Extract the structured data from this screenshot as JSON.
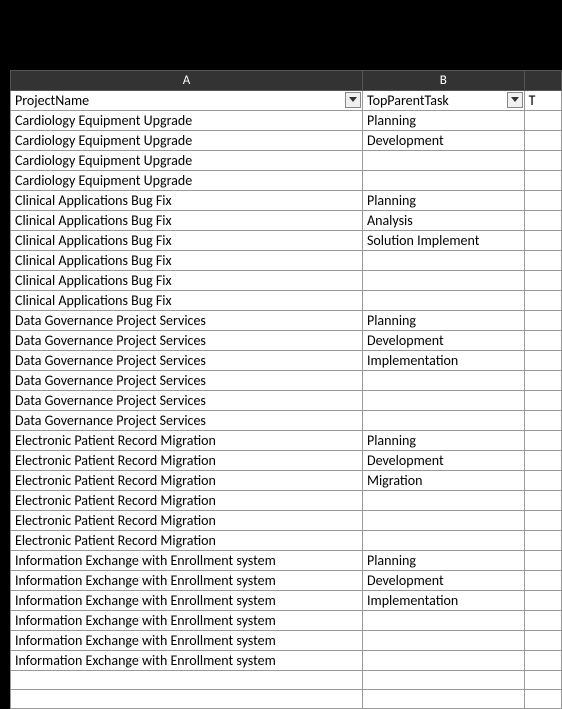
{
  "columns": {
    "A": "A",
    "B": "B",
    "C": ""
  },
  "headers": {
    "project": "ProjectName",
    "topparent": "TopParentTask",
    "partialC": "T"
  },
  "rows": [
    {
      "project": "Cardiology Equipment Upgrade",
      "topparent": "Planning"
    },
    {
      "project": "Cardiology Equipment Upgrade",
      "topparent": "Development"
    },
    {
      "project": "Cardiology Equipment Upgrade",
      "topparent": ""
    },
    {
      "project": "Cardiology Equipment Upgrade",
      "topparent": ""
    },
    {
      "project": "Clinical Applications Bug Fix",
      "topparent": "Planning"
    },
    {
      "project": "Clinical Applications Bug Fix",
      "topparent": "Analysis"
    },
    {
      "project": "Clinical Applications Bug Fix",
      "topparent": "Solution Implement"
    },
    {
      "project": "Clinical Applications Bug Fix",
      "topparent": ""
    },
    {
      "project": "Clinical Applications Bug Fix",
      "topparent": ""
    },
    {
      "project": "Clinical Applications Bug Fix",
      "topparent": ""
    },
    {
      "project": "Data Governance Project Services",
      "topparent": "Planning"
    },
    {
      "project": "Data Governance Project Services",
      "topparent": "Development"
    },
    {
      "project": "Data Governance Project Services",
      "topparent": "Implementation"
    },
    {
      "project": "Data Governance Project Services",
      "topparent": ""
    },
    {
      "project": "Data Governance Project Services",
      "topparent": ""
    },
    {
      "project": "Data Governance Project Services",
      "topparent": ""
    },
    {
      "project": "Electronic Patient Record Migration",
      "topparent": "Planning"
    },
    {
      "project": "Electronic Patient Record Migration",
      "topparent": "Development"
    },
    {
      "project": "Electronic Patient Record Migration",
      "topparent": "Migration"
    },
    {
      "project": "Electronic Patient Record Migration",
      "topparent": ""
    },
    {
      "project": "Electronic Patient Record Migration",
      "topparent": ""
    },
    {
      "project": "Electronic Patient Record Migration",
      "topparent": ""
    },
    {
      "project": "Information Exchange with Enrollment system",
      "topparent": "Planning"
    },
    {
      "project": "Information Exchange with Enrollment system",
      "topparent": "Development"
    },
    {
      "project": "Information Exchange with Enrollment system",
      "topparent": "Implementation"
    },
    {
      "project": "Information Exchange with Enrollment system",
      "topparent": ""
    },
    {
      "project": "Information Exchange with Enrollment system",
      "topparent": ""
    },
    {
      "project": "Information Exchange with Enrollment system",
      "topparent": ""
    }
  ]
}
